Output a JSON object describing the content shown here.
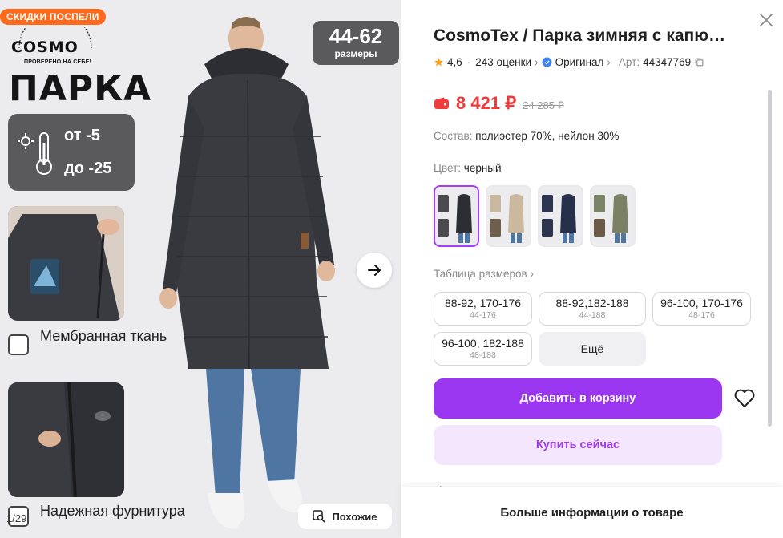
{
  "gallery": {
    "promo_badge": "СКИДКИ ПОСПЕЛИ",
    "brand_word": "COSMO",
    "brand_tag": "ПРОВЕРЕНО НА СЕБЕ!",
    "big_title": "ПАРКА",
    "temp_from": "от -5",
    "temp_to": "до -25",
    "sizes_range": "44-62",
    "sizes_label": "размеры",
    "feature_1": "Мембранная ткань",
    "feature_2": "Надежная фурнитура",
    "counter": "1/29",
    "similar_label": "Похожие"
  },
  "product": {
    "title": "CosmoTex / Парка зимняя с капю…",
    "rating": "4,6",
    "reviews": "243 оценки",
    "original": "Оригинал",
    "article_label": "Арт:",
    "article": "44347769",
    "price": "8 421 ₽",
    "old_price": "24 285 ₽",
    "composition_label": "Состав:",
    "composition": "полиэстер 70%, нейлон 30%",
    "color_label": "Цвет:",
    "color": "черный",
    "sizes_table": "Таблица размеров",
    "sizes": [
      {
        "size": "88-92, 170-176",
        "ru": "44-176"
      },
      {
        "size": "88-92,182-188",
        "ru": "44-188"
      },
      {
        "size": "96-100, 170-176",
        "ru": "48-176"
      },
      {
        "size": "96-100, 182-188",
        "ru": "48-188"
      }
    ],
    "more_sizes": "Ещё",
    "add_to_cart": "Добавить в корзину",
    "buy_now": "Купить сейчас",
    "more_info": "Больше информации о товаре"
  },
  "colors": {
    "accent": "#9a36f0",
    "price": "#f23a3a",
    "promo": "#ff6a1a"
  }
}
